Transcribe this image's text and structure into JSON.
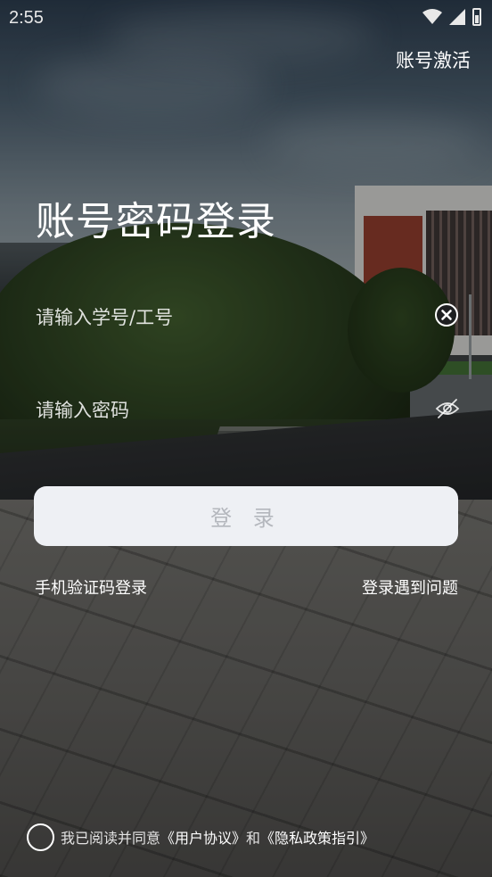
{
  "status_bar": {
    "time": "2:55"
  },
  "header": {
    "activate_label": "账号激活"
  },
  "title": "账号密码登录",
  "form": {
    "account_placeholder": "请输入学号/工号",
    "password_placeholder": "请输入密码",
    "login_label": "登 录"
  },
  "links": {
    "sms_login": "手机验证码登录",
    "login_help": "登录遇到问题"
  },
  "agreement": {
    "prefix": "我已阅读并同意",
    "user_agreement": "《用户协议》",
    "conjunction": "和",
    "privacy_policy": "《隐私政策指引》"
  },
  "colors": {
    "button_bg": "#eef0f4",
    "button_text": "#b4b7bd",
    "text": "#ffffff"
  },
  "icons": [
    "wifi-icon",
    "signal-icon",
    "battery-icon",
    "clear-icon",
    "eye-off-icon"
  ]
}
